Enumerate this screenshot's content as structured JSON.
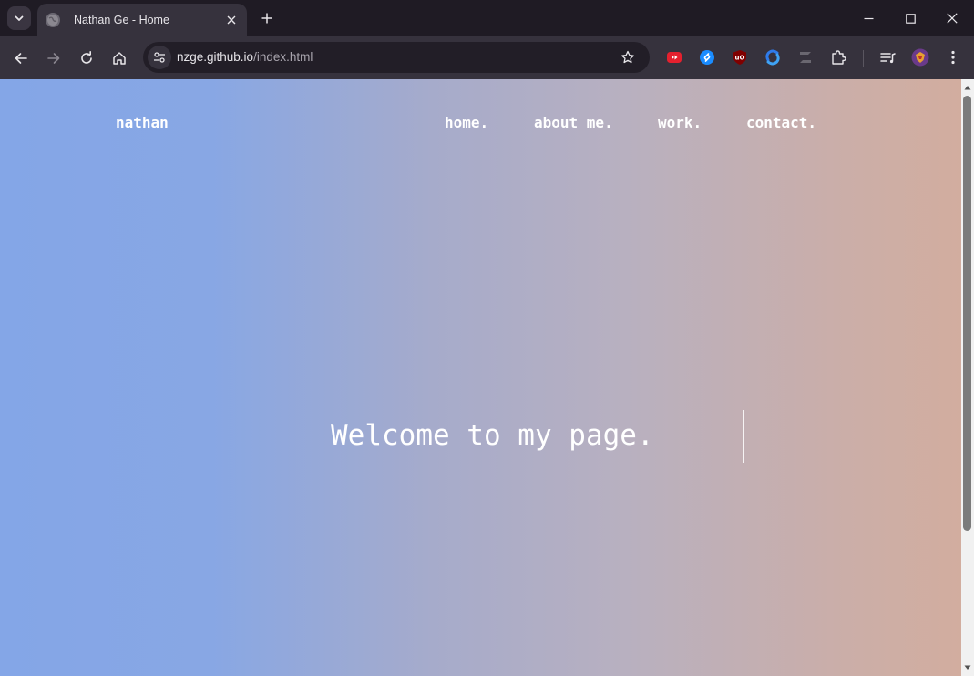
{
  "browser": {
    "tab": {
      "title": "Nathan Ge - Home"
    },
    "address": {
      "host": "nzge.github.io",
      "path": "/index.html"
    }
  },
  "page": {
    "logo": "nathan",
    "nav": [
      "home.",
      "about me.",
      "work.",
      "contact."
    ],
    "hero": "Welcome to my page."
  },
  "colors": {
    "gradient_left": "#84a6e7",
    "gradient_right": "#d2ad9f",
    "browser_frame": "#1f1b24",
    "toolbar": "#36323d"
  },
  "icons": {
    "tab_search": "chevron-down-icon",
    "favicon": "globe-icon",
    "extensions": [
      "youtube-speed-icon",
      "shazam-icon",
      "ublock-icon",
      "sync-icon",
      "zotero-icon",
      "puzzle-icon"
    ],
    "reading_list": "media-control-icon",
    "profile": "profile-avatar-icon",
    "menu": "kebab-menu-icon"
  }
}
